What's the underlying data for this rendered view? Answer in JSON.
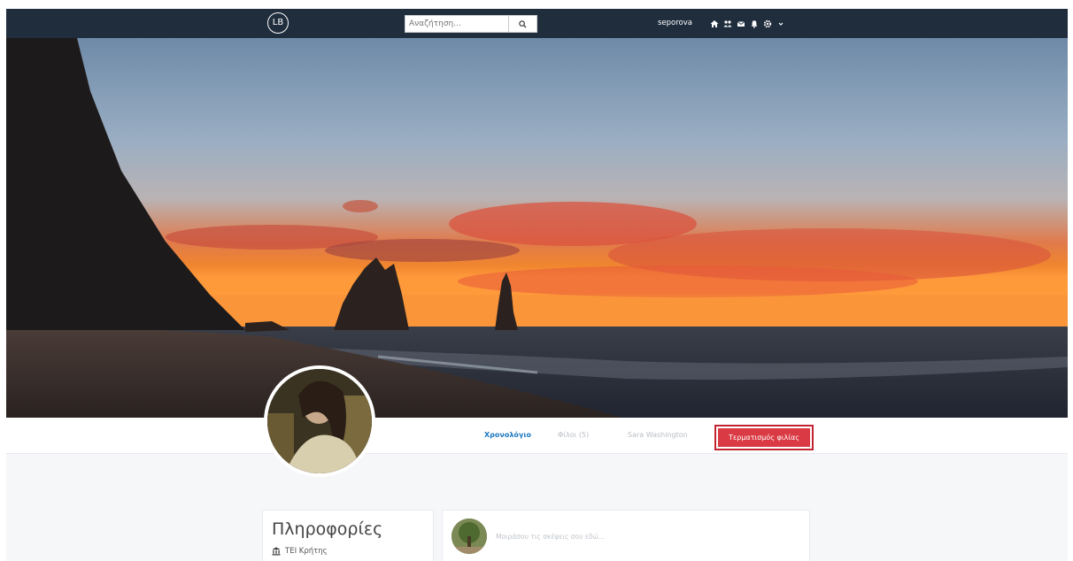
{
  "nav": {
    "logo_text": "LB",
    "search_placeholder": "Αναζήτηση...",
    "username": "seporova",
    "icons": [
      "home-icon",
      "friends-icon",
      "messages-icon",
      "notifications-icon",
      "settings-icon"
    ]
  },
  "tabs": {
    "timeline": "Χρονολόγιο",
    "friends": "Φίλοι (5)",
    "profile_name": "Sara Washington",
    "unfriend": "Τερματισμός φιλίας"
  },
  "info": {
    "title": "Πληροφορίες",
    "school": "ΤΕΙ Κρήτης"
  },
  "composer": {
    "placeholder": "Μοιράσου τις σκέψεις σου εδώ..."
  },
  "colors": {
    "navbar": "#1f2d3d",
    "accent": "#1d78c1",
    "danger": "#da3a44"
  }
}
